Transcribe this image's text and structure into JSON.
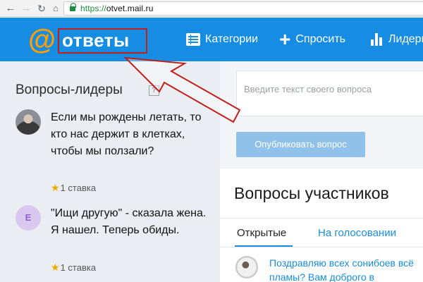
{
  "browser": {
    "url_scheme": "https://",
    "url_host": "otvet.mail.ru"
  },
  "header": {
    "logo_at": "@",
    "logo_text": "ответы",
    "nav": [
      {
        "label": "Категории",
        "icon": "list-icon"
      },
      {
        "label": "Спросить",
        "icon": "plus-icon"
      },
      {
        "label": "Лидеры",
        "icon": "bar-chart-icon"
      }
    ]
  },
  "leaders": {
    "title": "Вопросы-лидеры",
    "help": "?",
    "items": [
      {
        "text": "Если мы рождены летать, то кто нас держит в клетках, чтобы мы ползали?",
        "stake": "1 ставка"
      },
      {
        "avatar_letter": "E",
        "text": "\"Ищи другую\" - сказала жена. Я нашел. Теперь обиды.",
        "stake": "1 ставка"
      }
    ]
  },
  "ask": {
    "placeholder": "Введите текст своего вопроса",
    "publish_label": "Опубликовать вопрос"
  },
  "members": {
    "title": "Вопросы участников",
    "tabs": [
      "Открытые",
      "На голосовании"
    ],
    "feed": [
      {
        "text": "Поздравляю всех сонибоев всё пламы? Вам доброго в"
      }
    ]
  },
  "colors": {
    "header_blue": "#168de2",
    "logo_orange": "#ff9e00",
    "annotation_red": "#c0201a"
  }
}
